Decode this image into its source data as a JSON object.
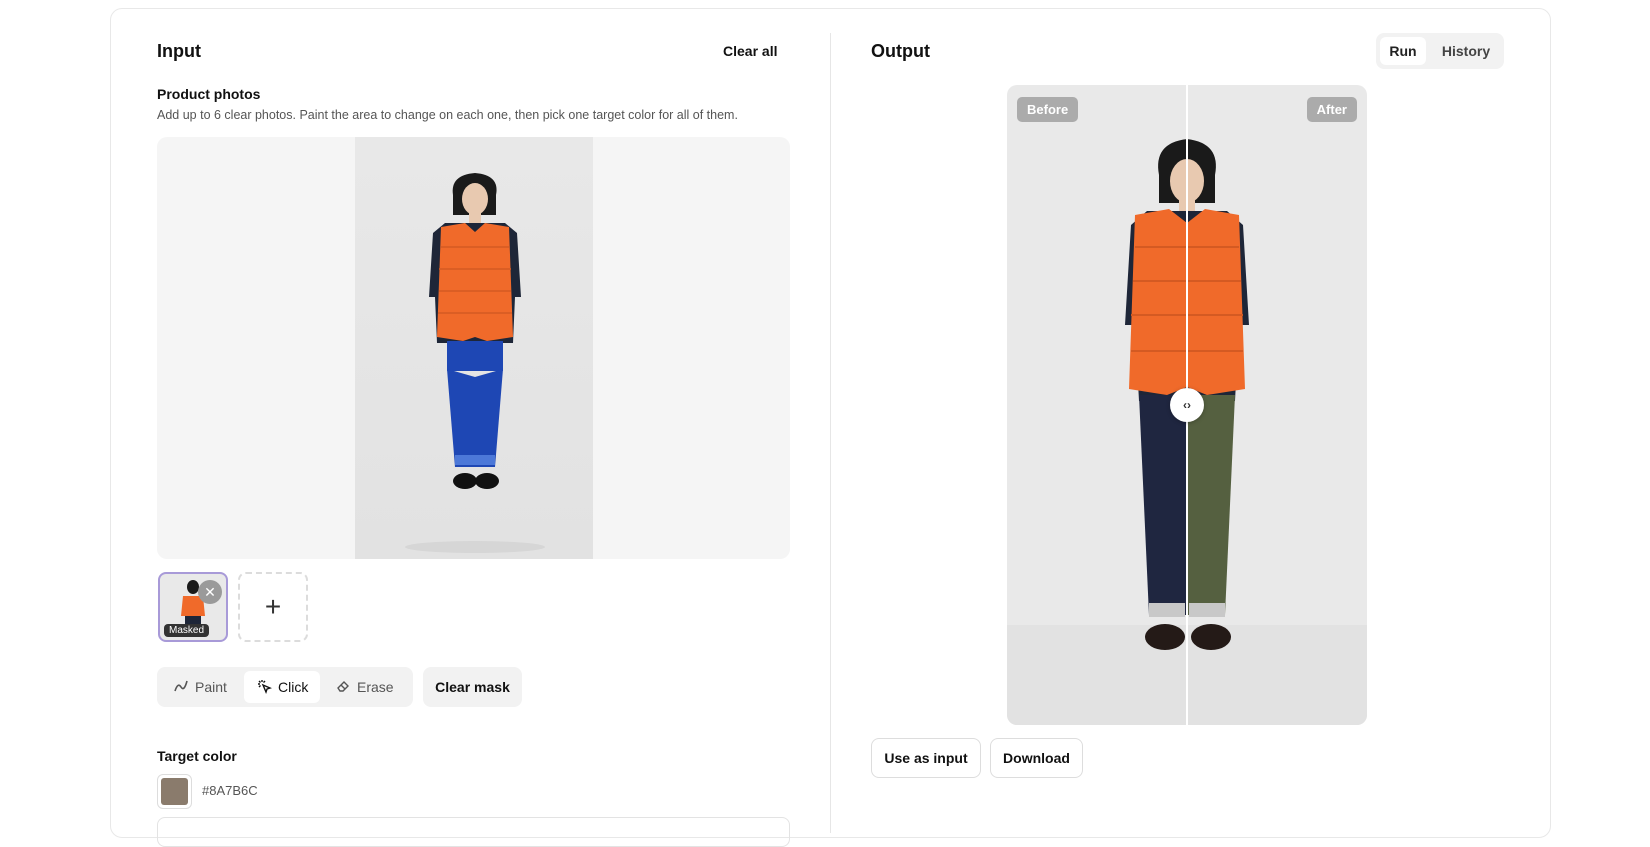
{
  "input": {
    "title": "Input",
    "clear_all": "Clear all",
    "photos_label": "Product photos",
    "photos_help": "Add up to 6 clear photos. Paint the area to change on each one, then pick one target color for all of them.",
    "thumb_badge": "Masked",
    "tools": [
      {
        "label": "Paint",
        "icon": "paint-brush-icon",
        "active": false
      },
      {
        "label": "Click",
        "icon": "magic-click-icon",
        "active": true
      },
      {
        "label": "Erase",
        "icon": "eraser-icon",
        "active": false
      }
    ],
    "clear_mask": "Clear mask",
    "target_color_label": "Target color",
    "target_color_hex": "#8A7B6C"
  },
  "output": {
    "title": "Output",
    "tabs": [
      {
        "label": "Run",
        "active": true
      },
      {
        "label": "History",
        "active": false
      }
    ],
    "before_label": "Before",
    "after_label": "After",
    "use_as_input": "Use as input",
    "download": "Download"
  },
  "colors": {
    "vest": "#F06A2A",
    "shirt": "#1E2638",
    "jeans_input": "#1E47B4",
    "jeans_before": "#1F2640",
    "pants_after": "#556040",
    "accent": "#A89AD8",
    "target": "#8A7B6C"
  }
}
